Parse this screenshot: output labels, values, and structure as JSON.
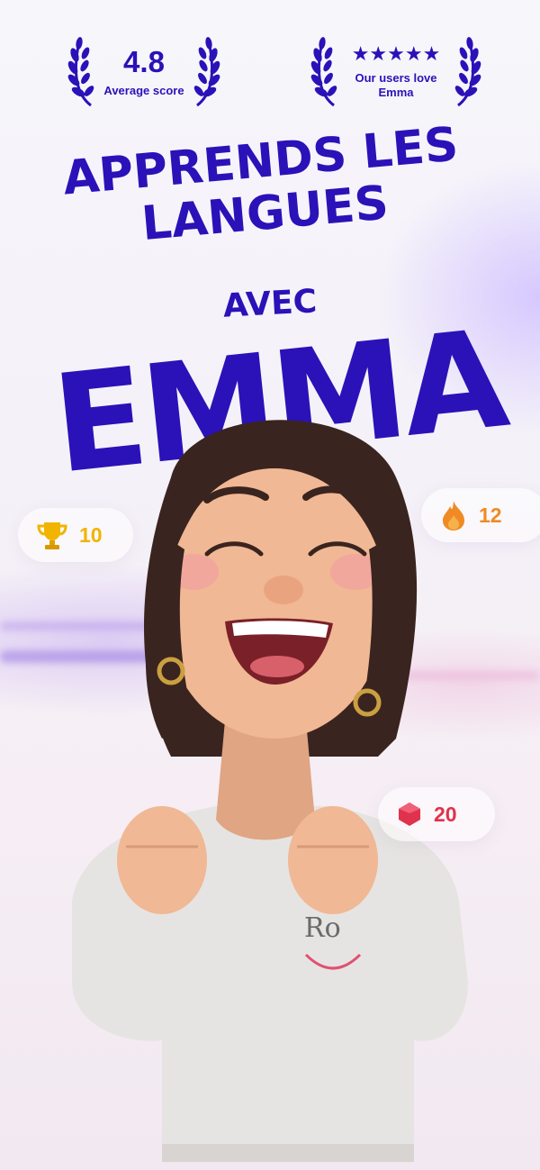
{
  "awards": {
    "score": {
      "value": "4.8",
      "label": "Average score"
    },
    "love": {
      "stars": "★★★★★",
      "label": "Our users love Emma"
    }
  },
  "headline": {
    "line1": "APPRENDS LES",
    "line2": "LANGUES",
    "avec": "AVEC",
    "emma": "EMMA"
  },
  "stats": {
    "trophies": {
      "icon": "trophy-icon",
      "value": "10",
      "color": "#f1b400"
    },
    "streak": {
      "icon": "fire-icon",
      "value": "12",
      "color": "#f08a24"
    },
    "gems": {
      "icon": "gem-icon",
      "value": "20",
      "color": "#e0324d"
    }
  },
  "colors": {
    "brand": "#2a12b8"
  }
}
